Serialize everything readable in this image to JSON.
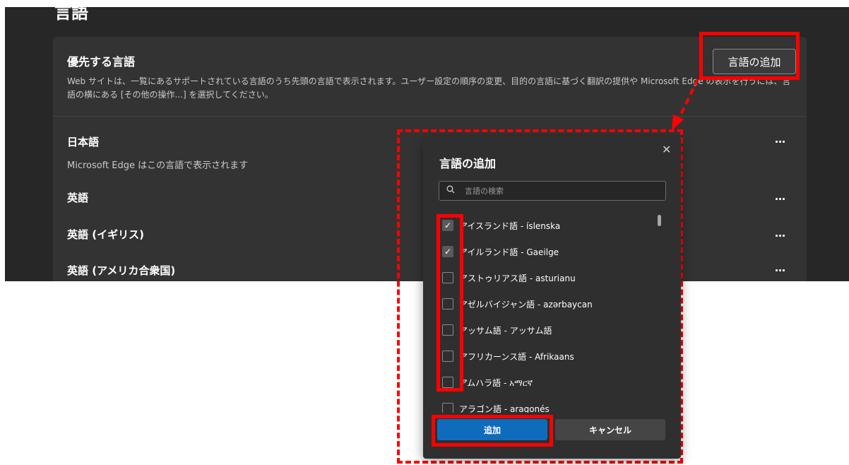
{
  "section": {
    "heading": "言語"
  },
  "preferred": {
    "title": "優先する言語",
    "description": "Web サイトは、一覧にあるサポートされている言語のうち先頭の言語で表示されます。ユーザー設定の順序の変更、目的の言語に基づく翻訳の提供や Microsoft Edge の表示を行うには、言語の横にある [その他の操作...] を選択してください。",
    "add_button": "言語の追加"
  },
  "languages": [
    {
      "name": "日本語",
      "subtitle": "Microsoft Edge はこの言語で表示されます"
    },
    {
      "name": "英語"
    },
    {
      "name": "英語 (イギリス)"
    },
    {
      "name": "英語 (アメリカ合衆国)"
    }
  ],
  "more_label": "…",
  "dialog": {
    "title": "言語の追加",
    "close": "✕",
    "search_placeholder": "言語の検索",
    "items": [
      {
        "label": "アイスランド語 - íslenska",
        "checked": true
      },
      {
        "label": "アイルランド語 - Gaeilge",
        "checked": true
      },
      {
        "label": "アストゥリアス語 - asturianu",
        "checked": false
      },
      {
        "label": "アゼルバイジャン語 - azərbaycan",
        "checked": false
      },
      {
        "label": "アッサム語 - アッサム語",
        "checked": false
      },
      {
        "label": "アフリカーンス語 - Afrikaans",
        "checked": false
      },
      {
        "label": "アムハラ語 - አማርኛ",
        "checked": false
      },
      {
        "label": "アラゴン語 - aragonés",
        "checked": false
      }
    ],
    "add_button": "追加",
    "cancel_button": "キャンセル"
  },
  "colors": {
    "annotation": "#ff0000",
    "primary": "#0f6cbd",
    "background": "#272727",
    "card": "#333333"
  }
}
